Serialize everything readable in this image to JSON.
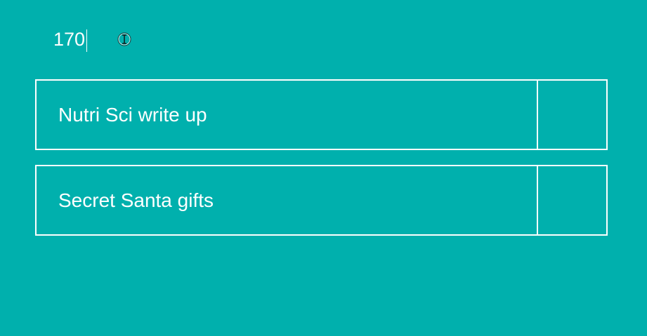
{
  "counter": {
    "value": "170"
  },
  "tasks": [
    {
      "label": "Nutri Sci write up"
    },
    {
      "label": "Secret Santa gifts"
    }
  ],
  "colors": {
    "background": "#00b0ad",
    "foreground": "#ffffff"
  },
  "icons": {
    "cursor": "text-cursor-ibeam-icon"
  }
}
